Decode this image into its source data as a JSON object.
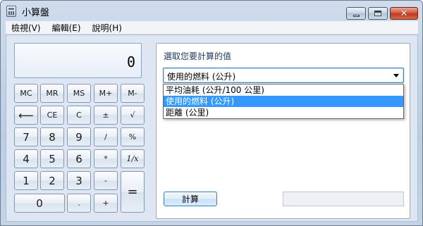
{
  "window": {
    "title": "小算盤"
  },
  "menu": [
    {
      "label": "檢視(V)"
    },
    {
      "label": "編輯(E)"
    },
    {
      "label": "說明(H)"
    }
  ],
  "display": {
    "value": "0"
  },
  "keys": {
    "mc": "MC",
    "mr": "MR",
    "ms": "MS",
    "mplus": "M+",
    "mminus": "M-",
    "backspace": "⟵",
    "ce": "CE",
    "c": "C",
    "plusminus": "±",
    "sqrt": "√",
    "seven": "7",
    "eight": "8",
    "nine": "9",
    "divide": "/",
    "percent": "%",
    "four": "4",
    "five": "5",
    "six": "6",
    "multiply": "*",
    "reciprocal": "1/x",
    "one": "1",
    "two": "2",
    "three": "3",
    "minus": "-",
    "equals": "=",
    "zero": "0",
    "dot": ".",
    "plus": "+"
  },
  "panel": {
    "label": "選取您要計算的值",
    "select_value": "使用的燃料 (公升)",
    "options": [
      {
        "label": "平均油耗 (公升/100 公里)"
      },
      {
        "label": "使用的燃料 (公升)"
      },
      {
        "label": "距離 (公里)"
      }
    ],
    "calculate_label": "計算",
    "result": ""
  }
}
